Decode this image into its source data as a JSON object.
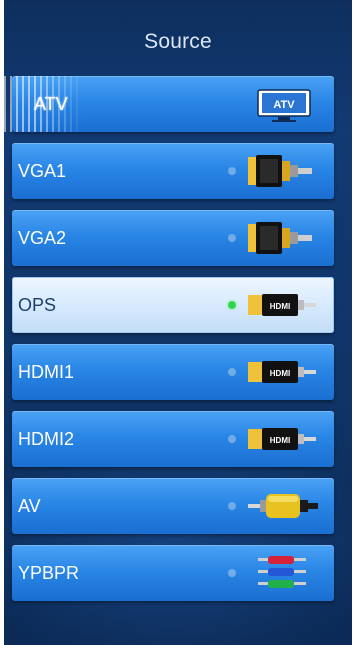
{
  "header": {
    "title": "Source"
  },
  "sources": [
    {
      "label": "ATV",
      "icon": "atv-tv-icon",
      "icon_text": "ATV",
      "selected": false
    },
    {
      "label": "VGA1",
      "icon": "vga-connector-icon",
      "selected": false
    },
    {
      "label": "VGA2",
      "icon": "vga-connector-icon",
      "selected": false
    },
    {
      "label": "OPS",
      "icon": "hdmi-connector-icon",
      "icon_text": "HDMI",
      "selected": true
    },
    {
      "label": "HDMI1",
      "icon": "hdmi-connector-icon",
      "icon_text": "HDMI",
      "selected": false
    },
    {
      "label": "HDMI2",
      "icon": "hdmi-connector-icon",
      "icon_text": "HDMI",
      "selected": false
    },
    {
      "label": "AV",
      "icon": "av-rca-connector-icon",
      "selected": false
    },
    {
      "label": "YPBPR",
      "icon": "ypbpr-component-connector-icon",
      "selected": false
    }
  ],
  "colors": {
    "panel_background": "#123a73",
    "item_background": "#2a86e6",
    "item_selected_background": "#d7eafd",
    "active_dot": "#35d34a",
    "inactive_dot": "#7fb3e6"
  }
}
